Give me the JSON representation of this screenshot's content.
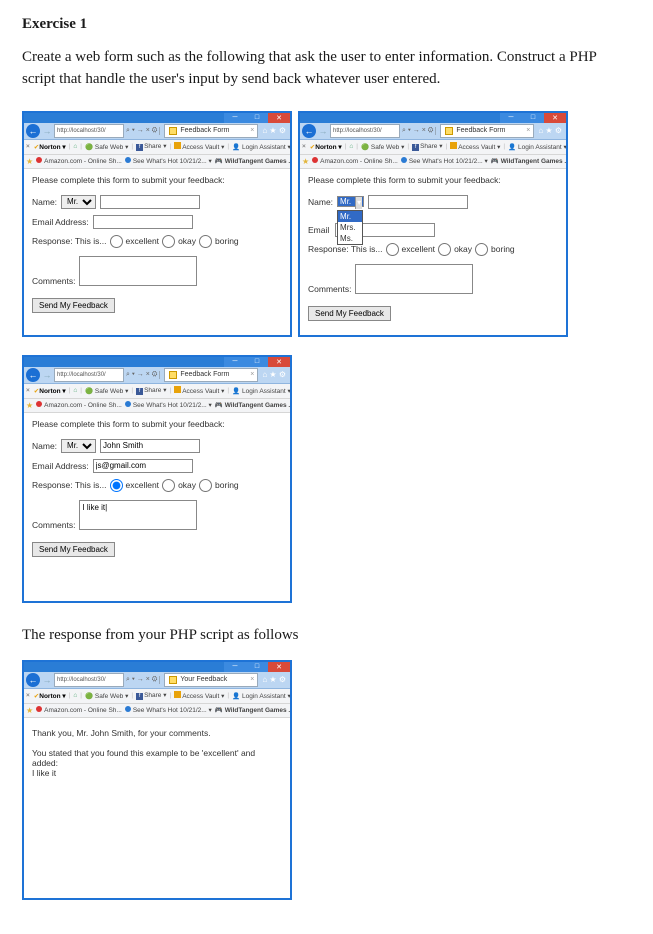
{
  "heading": "Exercise 1",
  "desc": "Create a web form such as the following that ask the user to enter information. Construct a PHP script that handle the user's input by send back whatever user entered.",
  "resp_intro": "The response from your PHP script as follows",
  "browser": {
    "url": "http://localhost/30/",
    "search_hint": "⌕",
    "addr_tail_icons": "⌕ ▾ → × ⚙",
    "tab_form": "Feedback Form",
    "tab_resp": "Your Feedback",
    "star_cluster": "⌂ ★ ⚙",
    "toolbar": {
      "close": "×",
      "norton": "Norton ▾",
      "home": "⌂",
      "safeweb": "Safe Web ▾",
      "share": "Share ▾",
      "access_vault": "Access Vault ▾",
      "login_assistant": "Login Assistant ▾"
    },
    "favbar": {
      "amazon": "Amazon.com - Online Sh...",
      "see": "See What's Hot 10/21/2... ▾",
      "wt": "WildTangent Games ... ▾"
    }
  },
  "form": {
    "prompt": "Please complete this form to submit your feedback:",
    "name_label": "Name:",
    "email_label": "Email Address:",
    "email_label_short": "Email",
    "response_label": "Response: This is...",
    "opt_excellent": "excellent",
    "opt_okay": "okay",
    "opt_boring": "boring",
    "comments_label": "Comments:",
    "submit": "Send My Feedback",
    "salutations": [
      "Mr.",
      "Mrs.",
      "Ms."
    ],
    "salutation_selected": "Mr.",
    "filled": {
      "name": "John Smith",
      "email": "js@gmail.com",
      "comments": "I like it|"
    }
  },
  "response": {
    "line1": "Thank you, Mr. John Smith, for your comments.",
    "line2": "You stated that you found this example to be 'excellent' and added:",
    "line3": "I like it"
  }
}
